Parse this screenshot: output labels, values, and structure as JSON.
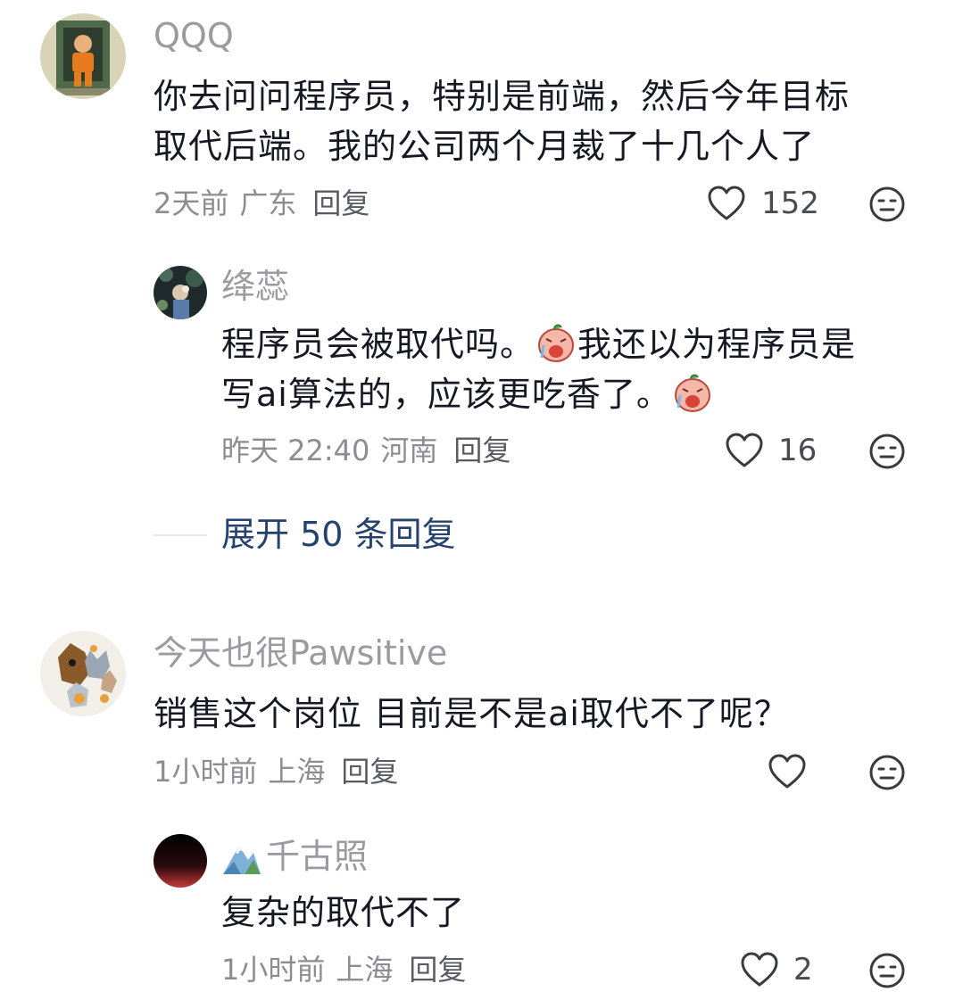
{
  "comments": [
    {
      "user": "QQQ",
      "text": "你去问问程序员，特别是前端，然后今年目标取代后端。我的公司两个月裁了十几个人了",
      "line1": "你去问问程序员，特别是前端，然后今年目标",
      "line2": "取代后端。我的公司两个月裁了十几个人了",
      "time": "2天前",
      "location": "广东",
      "reply_label": "回复",
      "likes": "152",
      "reply": {
        "user": "绛蕊",
        "line1_a": "程序员会被取代吗。",
        "line1_b": "我还以为程序员是",
        "line2": "写ai算法的，应该更吃香了。",
        "time": "昨天 22:40",
        "location": "河南",
        "reply_label": "回复",
        "likes": "16"
      },
      "expand_label": "展开 50 条回复"
    },
    {
      "user": "今天也很Pawsitive",
      "text": "销售这个岗位 目前是不是ai取代不了呢？",
      "time": "1小时前",
      "location": "上海",
      "reply_label": "回复",
      "likes": "",
      "reply": {
        "user": "千古照",
        "text": "复杂的取代不了",
        "time": "1小时前",
        "location": "上海",
        "reply_label": "回复",
        "likes": "2"
      }
    }
  ],
  "icons": {
    "like": "heart-outline-icon",
    "dislike": "neutral-face-icon",
    "emoji": "crying-face-sticker-icon",
    "badge": "mountain-badge-icon"
  },
  "colors": {
    "name": "#9a9aa0",
    "text": "#161823",
    "meta": "#8c8c92",
    "expand": "#25426e",
    "icon": "#3a3a42"
  }
}
